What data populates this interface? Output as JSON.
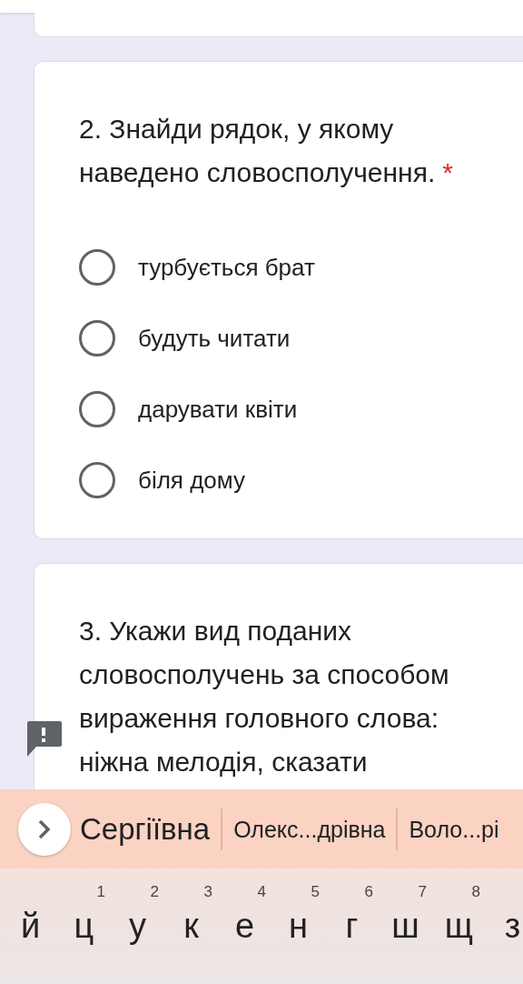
{
  "questions": [
    {
      "title": "2. Знайди рядок, у якому наведено словосполучення.",
      "required_mark": "*",
      "options": [
        {
          "label": "турбується брат",
          "selected": false
        },
        {
          "label": "будуть читати",
          "selected": false
        },
        {
          "label": "дарувати квіти",
          "selected": false
        },
        {
          "label": "біля дому",
          "selected": false
        }
      ]
    },
    {
      "title": "3. Укажи вид поданих словосполучень за способом вираження головного слова: ніжна мелодія, сказати"
    }
  ],
  "keyboard": {
    "suggestions": [
      "Сергіївна",
      "Олекс...дрівна",
      "Воло...рі"
    ],
    "keys": [
      {
        "char": "й"
      },
      {
        "char": "ц",
        "hint": "1"
      },
      {
        "char": "у",
        "hint": "2"
      },
      {
        "char": "к",
        "hint": "3"
      },
      {
        "char": "е",
        "hint": "4"
      },
      {
        "char": "н",
        "hint": "5"
      },
      {
        "char": "г",
        "hint": "6"
      },
      {
        "char": "ш",
        "hint": "7"
      },
      {
        "char": "щ",
        "hint": "8"
      },
      {
        "char": "з"
      }
    ]
  }
}
